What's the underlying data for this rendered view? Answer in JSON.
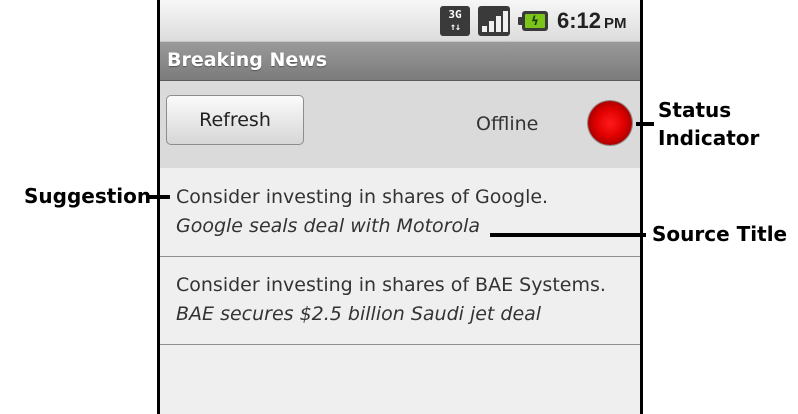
{
  "status_bar": {
    "network_badge": "3G",
    "network_icon": "3g-data-icon",
    "signal_icon": "signal-strength-icon",
    "battery_icon": "battery-charging-icon",
    "time": "6:12",
    "ampm": "PM"
  },
  "app": {
    "title": "Breaking News"
  },
  "toolbar": {
    "refresh_label": "Refresh",
    "status_text": "Offline",
    "status_color": "#e00000"
  },
  "news": [
    {
      "suggestion": "Consider investing in shares of Google.",
      "source": "Google seals deal with Motorola"
    },
    {
      "suggestion": "Consider investing in shares of BAE Systems.",
      "source": "BAE secures $2.5 billion Saudi jet deal"
    }
  ],
  "annotations": {
    "suggestion": "Suggestion",
    "source_title": "Source Title",
    "status_line1": "Status",
    "status_line2": "Indicator"
  }
}
